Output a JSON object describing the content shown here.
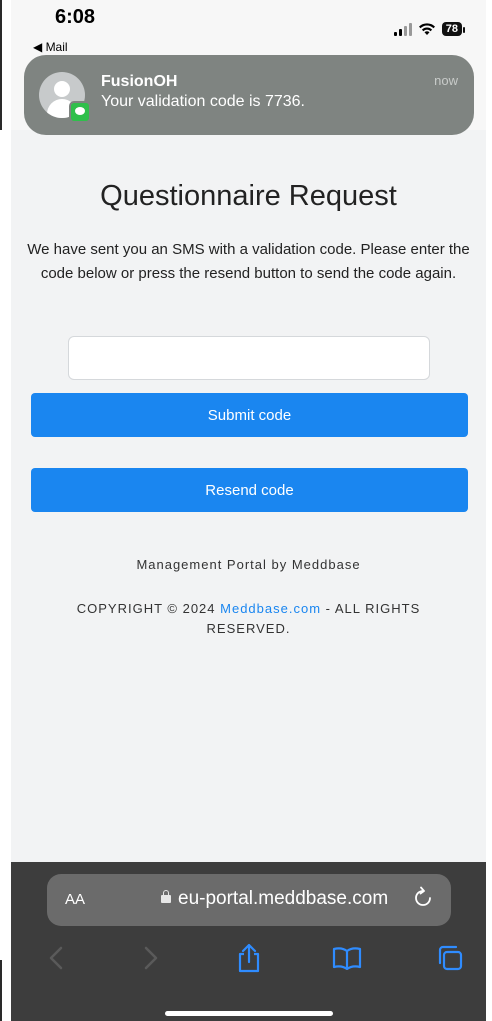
{
  "status_bar": {
    "time": "6:08",
    "back_app": "◀ Mail",
    "battery": "78"
  },
  "notification": {
    "app": "FusionOH",
    "message": "Your validation code is 7736.",
    "time": "now"
  },
  "page": {
    "heading": "Questionnaire Request",
    "description": "We have sent you an SMS with a validation code. Please enter the code below or press the resend button to send the code again.",
    "code_input_value": "",
    "submit_label": "Submit code",
    "resend_label": "Resend code",
    "footer_brand": "Management Portal by Meddbase",
    "copyright_prefix": "COPYRIGHT © 2024 ",
    "copyright_link": "Meddbase.com",
    "copyright_suffix": " - ALL RIGHTS RESERVED."
  },
  "browser": {
    "text_size_label": "AA",
    "url": "eu-portal.meddbase.com"
  },
  "colors": {
    "primary_button": "#1a86f0",
    "link": "#1a86f0",
    "toolbar": "#3d3d3d",
    "notification_bg": "#7f8481",
    "accent_icons": "#2f8cff"
  },
  "icons": [
    "signal-icon",
    "wifi-icon",
    "battery-icon",
    "contact-avatar-icon",
    "messages-badge-icon",
    "lock-icon",
    "reload-icon",
    "back-icon",
    "forward-icon",
    "share-icon",
    "bookmarks-icon",
    "tabs-icon"
  ]
}
